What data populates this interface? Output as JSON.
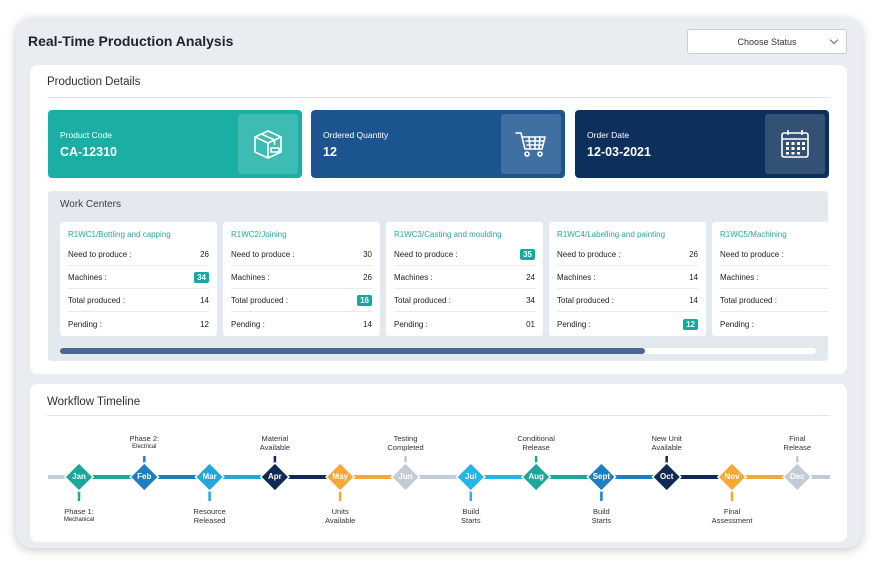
{
  "page_title": "Real-Time Production Analysis",
  "status_select": {
    "value": "Choose Status"
  },
  "production": {
    "title": "Production Details",
    "tiles": [
      {
        "label": "Product Code",
        "value": "CA-12310",
        "icon": "package-box-icon",
        "color": "#1aaea4"
      },
      {
        "label": "Ordered Quantity",
        "value": "12",
        "icon": "shopping-cart-icon",
        "color": "#1c5490"
      },
      {
        "label": "Order Date",
        "value": "12-03-2021",
        "icon": "calendar-icon",
        "color": "#0d2f5b"
      }
    ]
  },
  "work_centers": {
    "title": "Work Centers",
    "row_labels": [
      "Need to produce :",
      "Machines :",
      "Total produced :",
      "Pending :"
    ],
    "centers": [
      {
        "name": "R1WC1/Bottling and capping",
        "values": [
          "26",
          "34",
          "14",
          "12"
        ],
        "badge": 1
      },
      {
        "name": "R1WC2/Joining",
        "values": [
          "30",
          "26",
          "16",
          "14"
        ],
        "badge": 2
      },
      {
        "name": "R1WC3/Casting and moulding",
        "values": [
          "35",
          "24",
          "34",
          "01"
        ],
        "badge": 0
      },
      {
        "name": "R1WC4/Labelling and painting",
        "values": [
          "26",
          "14",
          "14",
          "12"
        ],
        "badge": 3
      },
      {
        "name": "R1WC5/Machining",
        "values": [
          "",
          "",
          "",
          ""
        ],
        "badge": -1
      }
    ],
    "scroll_fraction": 0.77
  },
  "workflow": {
    "title": "Workflow Timeline",
    "months": [
      {
        "label": "Jan",
        "color": "#1aa89b"
      },
      {
        "label": "Feb",
        "color": "#1d7fc1"
      },
      {
        "label": "Mar",
        "color": "#23a6dd"
      },
      {
        "label": "Apr",
        "color": "#0f2b55"
      },
      {
        "label": "May",
        "color": "#f7a737"
      },
      {
        "label": "Jun",
        "color": "#c3ccd6"
      },
      {
        "label": "Jul",
        "color": "#25b4e8"
      },
      {
        "label": "Aug",
        "color": "#1aa89b"
      },
      {
        "label": "Sept",
        "color": "#1d7fc1"
      },
      {
        "label": "Oct",
        "color": "#0f2b55"
      },
      {
        "label": "Nov",
        "color": "#f7a737"
      },
      {
        "label": "Dec",
        "color": "#c3ccd6"
      }
    ],
    "events": [
      {
        "main": "Phase 1:",
        "sub": "Mechanical",
        "pos": "below"
      },
      {
        "main": "Phase 2:",
        "sub": "Electrical",
        "pos": "above"
      },
      {
        "main": "Resource",
        "sub2": "Released",
        "pos": "below"
      },
      {
        "main": "Material",
        "sub2": "Available",
        "pos": "above"
      },
      {
        "main": "Units",
        "sub2": "Available",
        "pos": "below"
      },
      {
        "main": "Testing",
        "sub2": "Completed",
        "pos": "above"
      },
      {
        "main": "Build",
        "sub2": "Starts",
        "pos": "below"
      },
      {
        "main": "Conditional",
        "sub2": "Release",
        "pos": "above"
      },
      {
        "main": "Build",
        "sub2": "Starts",
        "pos": "below"
      },
      {
        "main": "New Unit",
        "sub2": "Available",
        "pos": "above"
      },
      {
        "main": "Final",
        "sub2": "Assessment",
        "pos": "below"
      },
      {
        "main": "Final",
        "sub2": "Release",
        "pos": "above"
      }
    ]
  }
}
